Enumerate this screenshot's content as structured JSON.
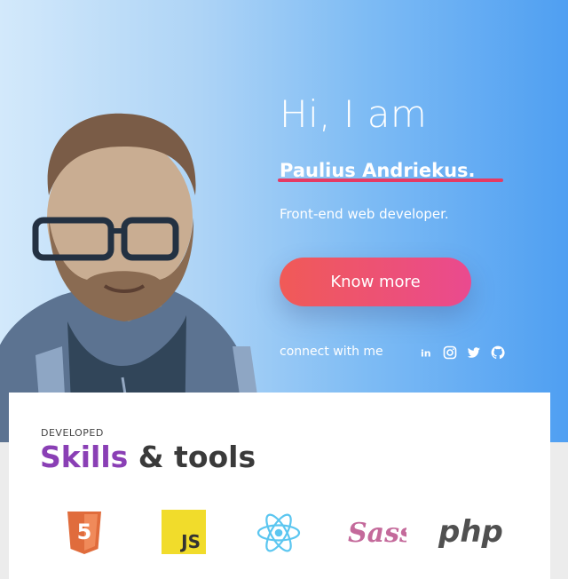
{
  "hero": {
    "greeting": "Hi, I am",
    "name": "Paulius Andriekus.",
    "role": "Front-end web developer.",
    "cta_label": "Know more",
    "connect_label": "connect with me",
    "social": [
      "linkedin-icon",
      "instagram-icon",
      "twitter-icon",
      "github-icon"
    ],
    "colors": {
      "gradient_start": "#d3e9fb",
      "gradient_end": "#4f9ff2",
      "underline": "#e53a63",
      "cta_start": "#f05a57",
      "cta_end": "#ea4a8f"
    }
  },
  "skills": {
    "eyebrow": "Developed",
    "title_accent": "Skills",
    "title_rest": " & tools",
    "accent_color": "#8a3fb5",
    "tools": [
      {
        "icon": "html5-icon",
        "text": "5"
      },
      {
        "icon": "javascript-icon",
        "text": "JS"
      },
      {
        "icon": "react-icon"
      },
      {
        "icon": "sass-icon",
        "text": "Sass"
      },
      {
        "icon": "php-icon",
        "text": "php"
      }
    ]
  }
}
